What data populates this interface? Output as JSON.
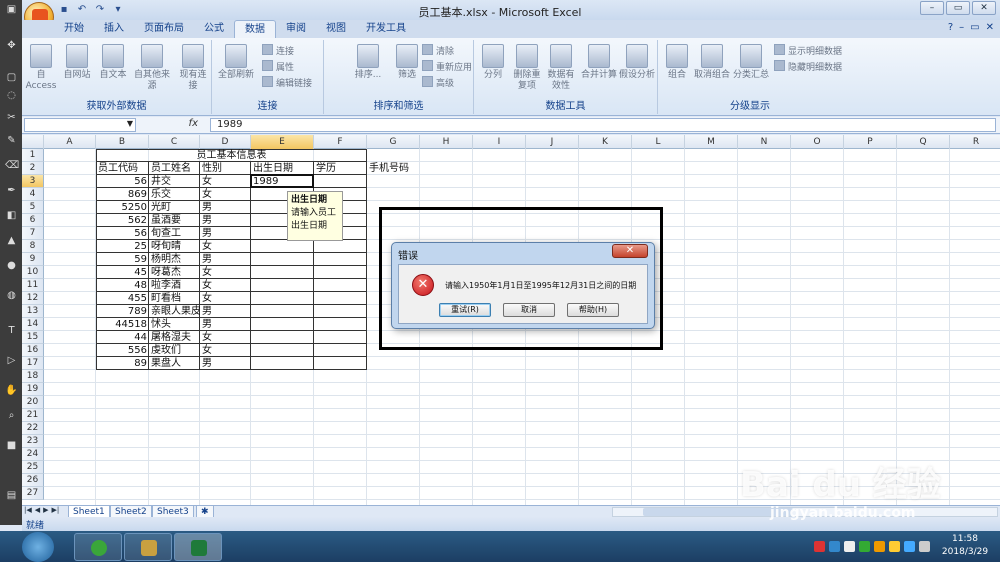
{
  "window": {
    "title": "员工基本.xlsx - Microsoft Excel"
  },
  "menu": {
    "tabs": [
      "开始",
      "插入",
      "页面布局",
      "公式",
      "数据",
      "审阅",
      "视图",
      "开发工具"
    ],
    "active": "数据"
  },
  "ribbon": {
    "groups": [
      {
        "label": "获取外部数据",
        "buttons": [
          "自 Access",
          "自网站",
          "自文本",
          "自其他来源",
          "现有连接"
        ]
      },
      {
        "label": "连接",
        "buttons": [
          "全部刷新"
        ],
        "small": [
          "连接",
          "属性",
          "编辑链接"
        ]
      },
      {
        "label": "排序和筛选",
        "buttons": [
          "排序...",
          "筛选"
        ],
        "small": [
          "清除",
          "重新应用",
          "高级"
        ]
      },
      {
        "label": "数据工具",
        "buttons": [
          "分列",
          "删除重复项",
          "数据有效性",
          "合并计算",
          "假设分析"
        ]
      },
      {
        "label": "分级显示",
        "buttons": [
          "组合",
          "取消组合",
          "分类汇总"
        ],
        "small": [
          "显示明细数据",
          "隐藏明细数据"
        ]
      }
    ]
  },
  "formula": {
    "fx": "fx",
    "value": "1989"
  },
  "columns": [
    "A",
    "B",
    "C",
    "D",
    "E",
    "F",
    "G",
    "H",
    "I",
    "J",
    "K",
    "L",
    "M",
    "N",
    "O",
    "P",
    "Q",
    "R"
  ],
  "rows": [
    "1",
    "2",
    "3",
    "4",
    "5",
    "6",
    "7",
    "8",
    "9",
    "10",
    "11",
    "12",
    "13",
    "14",
    "15",
    "16",
    "17",
    "18",
    "19",
    "20",
    "21",
    "22",
    "23",
    "24",
    "25",
    "26",
    "27"
  ],
  "table": {
    "title": "员工基本信息表",
    "headers": [
      "员工代码",
      "员工姓名",
      "性别",
      "出生日期",
      "学历",
      "手机号码"
    ],
    "data": [
      [
        "56",
        "井交",
        "女",
        "1989"
      ],
      [
        "869",
        "乐交",
        "女",
        ""
      ],
      [
        "5250",
        "光町",
        "男",
        ""
      ],
      [
        "562",
        "虽酒要",
        "男",
        ""
      ],
      [
        "56",
        "旬查工",
        "男",
        ""
      ],
      [
        "25",
        "呀旬晴",
        "女",
        ""
      ],
      [
        "59",
        "杨明杰",
        "男",
        ""
      ],
      [
        "45",
        "呀葛杰",
        "女",
        ""
      ],
      [
        "48",
        "啦李酒",
        "女",
        ""
      ],
      [
        "455",
        "町看档",
        "女",
        ""
      ],
      [
        "789",
        "亲眼人果皮",
        "男",
        ""
      ],
      [
        "44518",
        "怵头",
        "男",
        ""
      ],
      [
        "44",
        "屠格湿夫",
        "女",
        ""
      ],
      [
        "556",
        "虔玫们",
        "女",
        ""
      ],
      [
        "89",
        "果盘人",
        "男",
        ""
      ]
    ]
  },
  "tooltip": {
    "title": "出生日期",
    "line1": "请输入员工",
    "line2": "出生日期"
  },
  "sheets": [
    "Sheet1",
    "Sheet2",
    "Sheet3"
  ],
  "status": {
    "ready": "就绪"
  },
  "dialog": {
    "title": "错误",
    "message": "请输入1950年1月1日至1995年12月31日之间的日期",
    "buttons": [
      "重试(R)",
      "取消",
      "帮助(H)"
    ]
  },
  "clock": {
    "time": "11:58",
    "date": "2018/3/29"
  },
  "watermark": {
    "brand": "Bai du 经验",
    "url": "jingyan.baidu.com"
  }
}
